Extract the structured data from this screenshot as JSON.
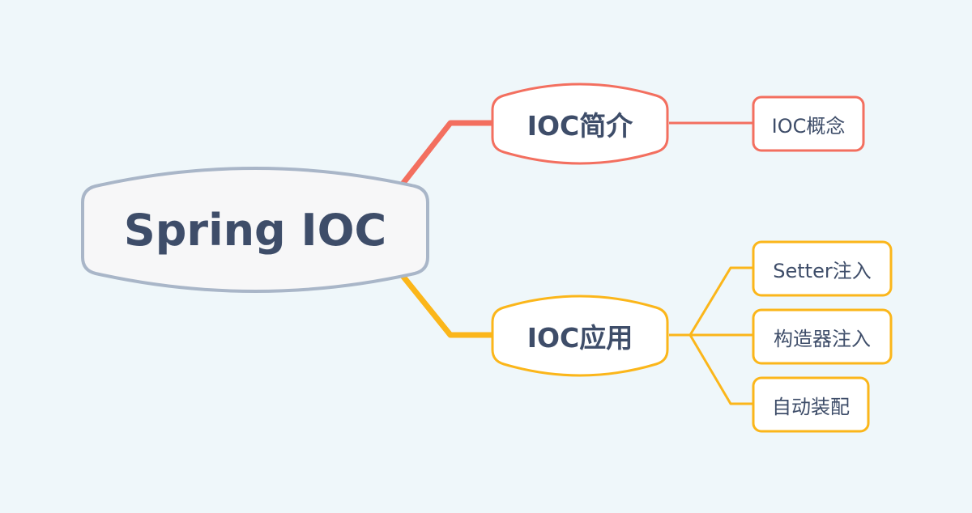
{
  "diagram": {
    "type": "mind-map",
    "colors": {
      "background": "#eff7fa",
      "root_border": "#a9b6c8",
      "root_fill": "#f7f7f8",
      "text": "#3e4d69",
      "branch_intro": "#f36f5f",
      "branch_app": "#fbb61a",
      "node_fill": "#ffffff"
    },
    "root": {
      "label": "Spring IOC"
    },
    "branches": [
      {
        "label": "IOC简介",
        "color": "#f36f5f",
        "children": [
          {
            "label": "IOC概念"
          }
        ]
      },
      {
        "label": "IOC应用",
        "color": "#fbb61a",
        "children": [
          {
            "label": "Setter注入"
          },
          {
            "label": "构造器注入"
          },
          {
            "label": "自动装配"
          }
        ]
      }
    ]
  }
}
